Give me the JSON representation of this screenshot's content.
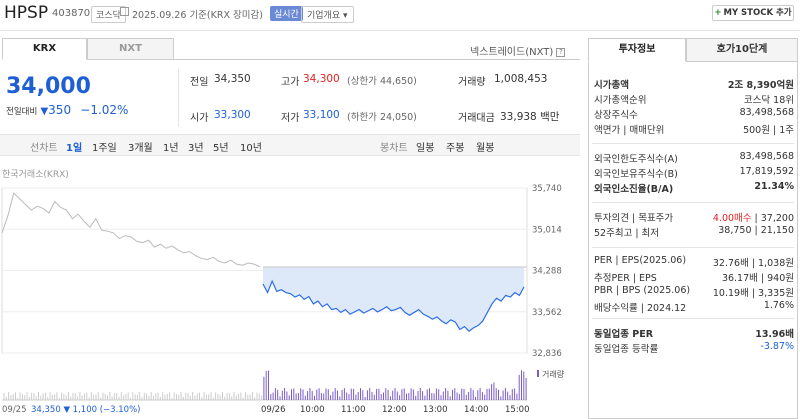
{
  "header": {
    "name": "HPSP",
    "code": "403870",
    "market": "코스닥",
    "date": "2025.09.26",
    "basis": "기준(KRX 장미감)",
    "realtime": "실시간",
    "corp_overview": "기업개요",
    "mystock_plus": "+",
    "mystock": "MY STOCK 추가"
  },
  "exchange_tabs": [
    "KRX",
    "NXT"
  ],
  "nextrade_label": "넥스트레이드(NXT)",
  "price": {
    "current": "34,000",
    "change_label": "전일대비",
    "change": "350",
    "change_pct": "−1.02%"
  },
  "stats": {
    "prev_label": "전일",
    "prev": "34,350",
    "high_label": "고가",
    "high": "34,300",
    "upper_limit": "(상한가 44,650)",
    "volume_label": "거래량",
    "volume": "1,008,453",
    "open_label": "시가",
    "open": "33,300",
    "low_label": "저가",
    "low": "33,100",
    "lower_limit": "(하한가 24,050)",
    "amount_label": "거래대금",
    "amount": "33,938",
    "amount_unit": "백만"
  },
  "periods": [
    "선차트",
    "1일",
    "1주일",
    "3개월",
    "1년",
    "3년",
    "5년",
    "10년"
  ],
  "active_period": "1일",
  "candle": [
    "봉차트",
    "일봉",
    "주봉",
    "월봉"
  ],
  "chart_source": "한국거래소(KRX)",
  "chart_data": {
    "type": "line",
    "y_ticks": [
      "35,740",
      "35,014",
      "34,288",
      "33,562",
      "32,836"
    ],
    "ylim": [
      32836,
      35740
    ],
    "reference": 34350,
    "volume_label": "거래량",
    "bottom": {
      "prev_date": "09/25",
      "prev_close": "34,350",
      "prev_change": "1,100",
      "prev_pct": "(−3.10%)",
      "day": "09/26",
      "times": [
        "10:00",
        "11:00",
        "12:00",
        "13:00",
        "14:00",
        "15:00"
      ]
    },
    "prev_day": [
      34950,
      35250,
      35650,
      35550,
      35450,
      35350,
      35420,
      35380,
      35300,
      35500,
      35400,
      35350,
      35200,
      35280,
      35150,
      35050,
      35200,
      35000,
      34980,
      34950,
      34850,
      34900,
      34880,
      34800,
      34780,
      34820,
      34700,
      34750,
      34680,
      34720,
      34650,
      34600,
      34620,
      34550,
      34500,
      34480,
      34520,
      34450,
      34420,
      34470,
      34400,
      34380,
      34420,
      34400,
      34350
    ],
    "today": [
      34050,
      33900,
      34100,
      33920,
      33950,
      33900,
      33880,
      33820,
      33860,
      33780,
      33830,
      33700,
      33750,
      33650,
      33700,
      33600,
      33620,
      33550,
      33600,
      33520,
      33560,
      33600,
      33540,
      33580,
      33620,
      33560,
      33600,
      33650,
      33580,
      33600,
      33640,
      33550,
      33500,
      33550,
      33600,
      33520,
      33480,
      33430,
      33470,
      33400,
      33350,
      33420,
      33380,
      33250,
      33300,
      33220,
      33280,
      33320,
      33400,
      33550,
      33700,
      33800,
      33750,
      33850,
      33820,
      33900,
      33850,
      34000
    ]
  },
  "right_panel": {
    "tabs": [
      "투자정보",
      "호가10단계"
    ],
    "rows": [
      {
        "label": "시가총액",
        "value": "2조 8,390억원",
        "bold": true
      },
      {
        "label": "시가총액순위",
        "value": "코스닥 18위"
      },
      {
        "label": "상장주식수",
        "value": "83,498,568"
      },
      {
        "label": "액면가 | 매매단위",
        "value": "500원 | 1주"
      },
      {
        "label": "외국인한도주식수(A)",
        "value": "83,498,568"
      },
      {
        "label": "외국인보유주식수(B)",
        "value": "17,819,592"
      },
      {
        "label": "외국인소진율(B/A)",
        "value": "21.34%",
        "bold": true
      },
      {
        "label": "투자의견 | 목표주가",
        "value_red": "4.00매수",
        "value": " | 37,200"
      },
      {
        "label": "52주최고 | 최저",
        "value": "38,750 | 21,150"
      },
      {
        "label": "PER | EPS(2025.06)",
        "value": "32.76배 | 1,038원"
      },
      {
        "label": "추정PER | EPS",
        "value": "36.17배 | 940원"
      },
      {
        "label": "PBR | BPS (2025.06)",
        "value": "10.19배 | 3,335원"
      },
      {
        "label": "배당수익률 | 2024.12",
        "value": "1.76%"
      },
      {
        "label": "동일업종 PER",
        "value": "13.96배",
        "bold": true
      },
      {
        "label": "동일업종 등락률",
        "value": "-3.87%",
        "blue": true
      }
    ]
  }
}
